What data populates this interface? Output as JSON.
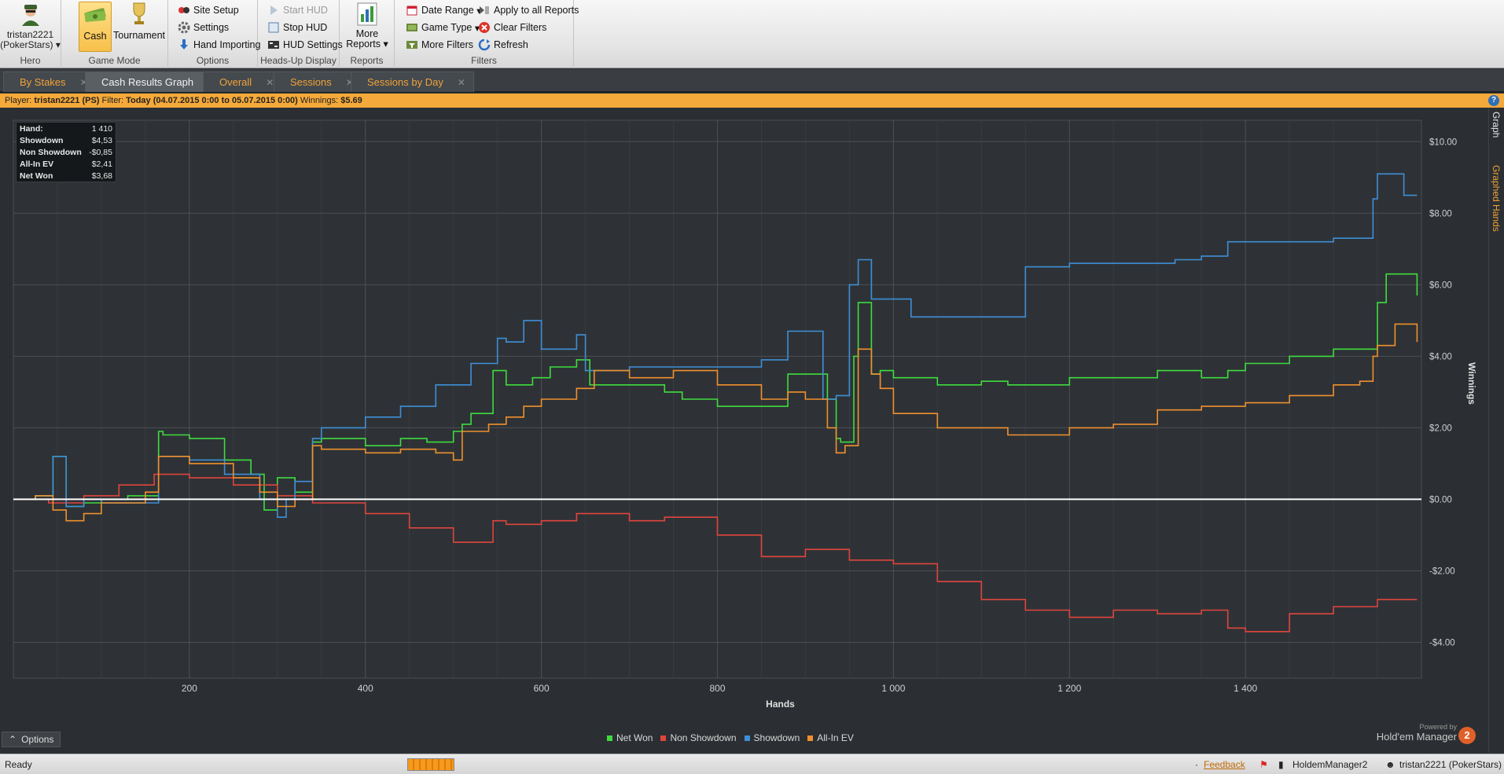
{
  "ribbon": {
    "hero": {
      "name": "tristan2221",
      "site": "(PokerStars)",
      "group_label": "Hero"
    },
    "game_mode": {
      "cash_label": "Cash",
      "tournament_label": "Tournament",
      "group_label": "Game Mode"
    },
    "options": {
      "site_setup": "Site Setup",
      "settings": "Settings",
      "hand_importing": "Hand Importing",
      "group_label": "Options"
    },
    "hud": {
      "start_hud": "Start HUD",
      "stop_hud": "Stop HUD",
      "hud_settings": "HUD Settings",
      "group_label": "Heads-Up Display"
    },
    "reports": {
      "more_reports_line1": "More",
      "more_reports_line2": "Reports",
      "group_label": "Reports"
    },
    "filters": {
      "date_range": "Date Range",
      "game_type": "Game Type",
      "more_filters": "More Filters",
      "apply_all": "Apply to all Reports",
      "clear_filters": "Clear Filters",
      "refresh": "Refresh",
      "group_label": "Filters"
    }
  },
  "tabs": [
    {
      "label": "By Stakes",
      "active": false
    },
    {
      "label": "Cash Results Graph",
      "active": true
    },
    {
      "label": "Overall",
      "active": false
    },
    {
      "label": "Sessions",
      "active": false
    },
    {
      "label": "Sessions by Day",
      "active": false
    }
  ],
  "infobar": {
    "player_label": "Player:",
    "player": "tristan2221 (PS)",
    "filter_label": "Filter:",
    "filter": "Today (04.07.2015 0:00 to 05.07.2015 0:00)",
    "winnings_label": "Winnings:",
    "winnings": "$5.69",
    "help": "?"
  },
  "side_tabs": {
    "graph": "Graph",
    "graphed_hands": "Graphed Hands"
  },
  "stats": [
    {
      "label": "Hand:",
      "value": "1 410"
    },
    {
      "label": "Showdown",
      "value": "$4,53"
    },
    {
      "label": "Non Showdown",
      "value": "-$0,85"
    },
    {
      "label": "All-In EV",
      "value": "$2,41"
    },
    {
      "label": "Net Won",
      "value": "$3,68"
    }
  ],
  "options_button": "Options",
  "powered_by": {
    "line1": "Powered by",
    "line2": "Hold'em Manager",
    "badge": "2"
  },
  "status": {
    "ready": "Ready",
    "feedback": "Feedback",
    "app": "HoldemManager2",
    "user": "tristan2221 (PokerStars)"
  },
  "colors": {
    "net_won": "#3fdc3f",
    "non_showdown": "#e0443e",
    "showdown": "#3e8fd8",
    "all_in_ev": "#f0902e",
    "accent": "#f5a93a"
  },
  "chart_data": {
    "type": "line",
    "xlabel": "Hands",
    "ylabel": "Winnings",
    "xlim": [
      0,
      1600
    ],
    "ylim": [
      -5,
      10.6
    ],
    "x_ticks": [
      200,
      400,
      600,
      800,
      1000,
      1200,
      1400
    ],
    "x_tick_labels": [
      "200",
      "400",
      "600",
      "800",
      "1 000",
      "1 200",
      "1 400"
    ],
    "y_ticks": [
      10,
      8,
      6,
      4,
      2,
      0,
      -2,
      -4
    ],
    "y_tick_labels": [
      "$10.00",
      "$8.00",
      "$6.00",
      "$4.00",
      "$2.00",
      "$0.00",
      "-$2.00",
      "-$4.00"
    ],
    "grid": true,
    "legend_position": "bottom-center",
    "series": [
      {
        "name": "Net Won",
        "color": "#3fdc3f",
        "x": [
          0,
          25,
          45,
          60,
          80,
          100,
          130,
          165,
          170,
          200,
          240,
          270,
          285,
          300,
          320,
          340,
          350,
          400,
          440,
          470,
          500,
          510,
          520,
          545,
          560,
          590,
          610,
          640,
          655,
          680,
          700,
          740,
          760,
          800,
          850,
          880,
          900,
          925,
          935,
          940,
          955,
          960,
          975,
          985,
          1000,
          1050,
          1100,
          1130,
          1200,
          1250,
          1300,
          1350,
          1380,
          1400,
          1450,
          1500,
          1530,
          1550,
          1560,
          1580,
          1595
        ],
        "y": [
          0.0,
          0.1,
          1.2,
          -0.2,
          -0.1,
          0.0,
          0.1,
          1.9,
          1.8,
          1.7,
          1.1,
          0.7,
          -0.3,
          0.6,
          0.2,
          1.6,
          1.7,
          1.5,
          1.7,
          1.6,
          1.9,
          2.1,
          2.4,
          3.6,
          3.2,
          3.4,
          3.7,
          3.9,
          3.2,
          3.2,
          3.2,
          3.0,
          2.8,
          2.6,
          2.6,
          3.5,
          3.5,
          2.8,
          1.7,
          1.6,
          4.0,
          5.5,
          3.5,
          3.6,
          3.4,
          3.2,
          3.3,
          3.2,
          3.4,
          3.4,
          3.6,
          3.4,
          3.6,
          3.8,
          4.0,
          4.2,
          4.2,
          5.5,
          6.3,
          6.3,
          5.7
        ]
      },
      {
        "name": "Non Showdown",
        "color": "#e0443e",
        "x": [
          0,
          40,
          80,
          120,
          160,
          200,
          250,
          300,
          340,
          400,
          450,
          500,
          545,
          560,
          600,
          640,
          660,
          700,
          740,
          800,
          850,
          900,
          950,
          1000,
          1050,
          1100,
          1150,
          1200,
          1250,
          1300,
          1350,
          1380,
          1400,
          1450,
          1500,
          1550,
          1595
        ],
        "y": [
          0.0,
          -0.1,
          0.1,
          0.4,
          0.7,
          0.6,
          0.4,
          0.1,
          -0.1,
          -0.4,
          -0.8,
          -1.2,
          -0.6,
          -0.7,
          -0.6,
          -0.4,
          -0.4,
          -0.6,
          -0.5,
          -1.0,
          -1.6,
          -1.4,
          -1.7,
          -1.8,
          -2.3,
          -2.8,
          -3.1,
          -3.3,
          -3.1,
          -3.2,
          -3.1,
          -3.6,
          -3.7,
          -3.2,
          -3.0,
          -2.8,
          -2.8
        ]
      },
      {
        "name": "Showdown",
        "color": "#3e8fd8",
        "x": [
          0,
          25,
          45,
          60,
          80,
          100,
          150,
          165,
          200,
          240,
          280,
          300,
          310,
          320,
          340,
          350,
          400,
          440,
          480,
          520,
          550,
          560,
          570,
          580,
          600,
          640,
          650,
          700,
          800,
          850,
          880,
          900,
          920,
          935,
          950,
          960,
          975,
          985,
          1000,
          1020,
          1080,
          1100,
          1150,
          1200,
          1240,
          1300,
          1320,
          1350,
          1380,
          1420,
          1460,
          1500,
          1530,
          1545,
          1550,
          1570,
          1580,
          1595
        ],
        "y": [
          0.0,
          0.1,
          1.2,
          -0.2,
          0.0,
          -0.1,
          -0.1,
          1.2,
          1.1,
          0.7,
          0.0,
          -0.5,
          0.0,
          0.5,
          1.7,
          2.0,
          2.3,
          2.6,
          3.2,
          3.8,
          4.5,
          4.4,
          4.4,
          5.0,
          4.2,
          4.6,
          3.6,
          3.7,
          3.7,
          3.9,
          4.7,
          4.7,
          2.8,
          2.9,
          6.0,
          6.7,
          5.6,
          5.6,
          5.6,
          5.1,
          5.1,
          5.1,
          6.5,
          6.6,
          6.6,
          6.6,
          6.7,
          6.8,
          7.2,
          7.2,
          7.2,
          7.3,
          7.3,
          8.4,
          9.1,
          9.1,
          8.5,
          8.5
        ]
      },
      {
        "name": "All-In EV",
        "color": "#f0902e",
        "x": [
          0,
          25,
          45,
          60,
          80,
          100,
          150,
          165,
          200,
          250,
          280,
          300,
          320,
          340,
          350,
          400,
          440,
          480,
          500,
          510,
          540,
          560,
          580,
          600,
          640,
          660,
          700,
          750,
          800,
          850,
          880,
          900,
          925,
          935,
          945,
          960,
          975,
          985,
          1000,
          1050,
          1100,
          1130,
          1200,
          1250,
          1300,
          1350,
          1400,
          1450,
          1500,
          1530,
          1545,
          1550,
          1570,
          1585,
          1595
        ],
        "y": [
          0.0,
          0.1,
          -0.3,
          -0.6,
          -0.4,
          -0.1,
          0.2,
          1.2,
          1.0,
          0.6,
          0.2,
          -0.2,
          0.0,
          1.5,
          1.4,
          1.3,
          1.4,
          1.3,
          1.1,
          1.9,
          2.1,
          2.3,
          2.6,
          2.8,
          3.1,
          3.6,
          3.4,
          3.6,
          3.2,
          2.8,
          3.0,
          2.8,
          2.0,
          1.3,
          1.5,
          4.2,
          3.5,
          3.1,
          2.4,
          2.0,
          2.0,
          1.8,
          2.0,
          2.1,
          2.5,
          2.6,
          2.7,
          2.9,
          3.2,
          3.3,
          4.0,
          4.3,
          4.9,
          4.9,
          4.4
        ]
      }
    ]
  }
}
